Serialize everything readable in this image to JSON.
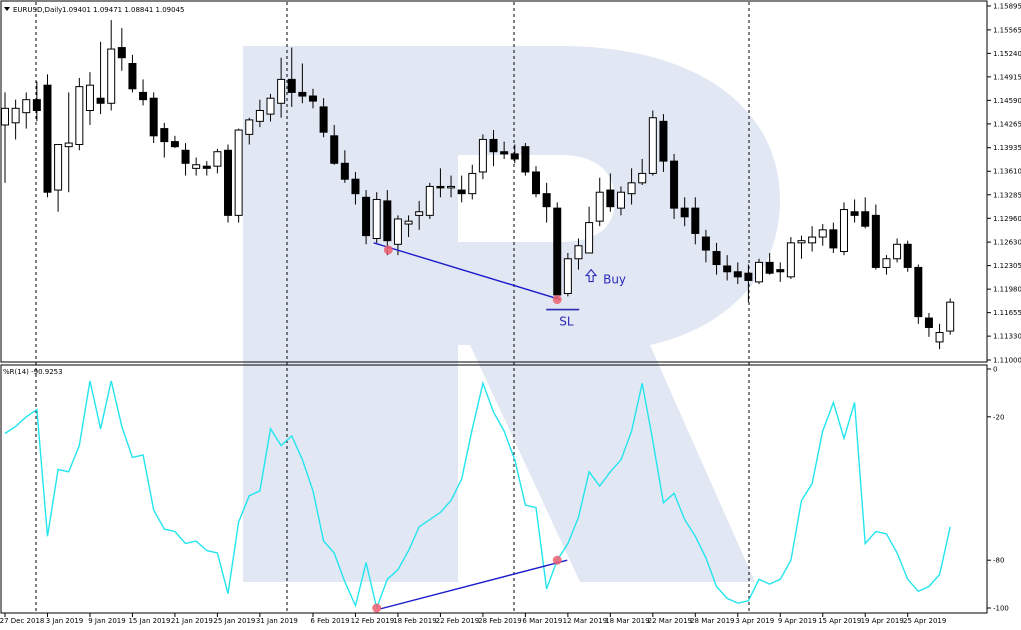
{
  "window": {
    "symbol_title": "EURUSD,Daily",
    "ohlc_text": "1.09401 1.09471 1.08841 1.09045"
  },
  "indicator": {
    "title": "%R(14) -90.9253"
  },
  "annotations": {
    "buy": "Buy",
    "sl": "SL"
  },
  "colors": {
    "bull_fill": "#ffffff",
    "bear_fill": "#000000",
    "wick": "#000000",
    "wpr_line": "#22e5ee",
    "divergence_line": "#1c1ccc",
    "marker": "#ef5f6e",
    "annotation": "#2a2ab8",
    "watermark": "#dde3f2",
    "grid": "#000000"
  },
  "chart_data": [
    {
      "type": "candlestick",
      "title": "EURUSD,Daily",
      "price_axis_ticks": [
        "1.15895",
        "1.15565",
        "1.15240",
        "1.14915",
        "1.14590",
        "1.14265",
        "1.13935",
        "1.13610",
        "1.13285",
        "1.12960",
        "1.12630",
        "1.12305",
        "1.11980",
        "1.11655",
        "1.11330",
        "1.11000"
      ],
      "ylim": [
        1.11,
        1.15895
      ],
      "date_axis_labels": [
        "27 Dec 2018",
        "3 Jan 2019",
        "9 Jan 2019",
        "15 Jan 2019",
        "21 Jan 2019",
        "25 Jan 2019",
        "31 Jan 2019",
        "6 Feb 2019",
        "12 Feb 2019",
        "18 Feb 2019",
        "22 Feb 2019",
        "28 Feb 2019",
        "6 Mar 2019",
        "12 Mar 2019",
        "18 Mar 2019",
        "22 Mar 2019",
        "28 Mar 2019",
        "3 Apr 2019",
        "9 Apr 2019",
        "15 Apr 2019",
        "19 Apr 2019",
        "25 Apr 2019"
      ],
      "candles": [
        {
          "o": 1.1425,
          "h": 1.147,
          "l": 1.1345,
          "c": 1.1448
        },
        {
          "o": 1.1428,
          "h": 1.146,
          "l": 1.1405,
          "c": 1.1448
        },
        {
          "o": 1.1442,
          "h": 1.147,
          "l": 1.142,
          "c": 1.146
        },
        {
          "o": 1.146,
          "h": 1.1485,
          "l": 1.143,
          "c": 1.1445
        },
        {
          "o": 1.148,
          "h": 1.1495,
          "l": 1.1325,
          "c": 1.1332
        },
        {
          "o": 1.1335,
          "h": 1.1398,
          "l": 1.1305,
          "c": 1.1398
        },
        {
          "o": 1.1395,
          "h": 1.147,
          "l": 1.1332,
          "c": 1.14
        },
        {
          "o": 1.1398,
          "h": 1.149,
          "l": 1.139,
          "c": 1.1478
        },
        {
          "o": 1.1445,
          "h": 1.1498,
          "l": 1.1425,
          "c": 1.148
        },
        {
          "o": 1.1462,
          "h": 1.154,
          "l": 1.144,
          "c": 1.1455
        },
        {
          "o": 1.1455,
          "h": 1.157,
          "l": 1.1445,
          "c": 1.153
        },
        {
          "o": 1.1532,
          "h": 1.1559,
          "l": 1.15,
          "c": 1.1518
        },
        {
          "o": 1.151,
          "h": 1.1522,
          "l": 1.147,
          "c": 1.1475
        },
        {
          "o": 1.147,
          "h": 1.1488,
          "l": 1.1452,
          "c": 1.146
        },
        {
          "o": 1.1462,
          "h": 1.147,
          "l": 1.14,
          "c": 1.141
        },
        {
          "o": 1.142,
          "h": 1.1428,
          "l": 1.138,
          "c": 1.1402
        },
        {
          "o": 1.1402,
          "h": 1.141,
          "l": 1.1393,
          "c": 1.1395
        },
        {
          "o": 1.139,
          "h": 1.14,
          "l": 1.1355,
          "c": 1.1372
        },
        {
          "o": 1.1365,
          "h": 1.138,
          "l": 1.1355,
          "c": 1.137
        },
        {
          "o": 1.1368,
          "h": 1.1375,
          "l": 1.1355,
          "c": 1.1365
        },
        {
          "o": 1.1368,
          "h": 1.1392,
          "l": 1.1358,
          "c": 1.1388
        },
        {
          "o": 1.139,
          "h": 1.1398,
          "l": 1.129,
          "c": 1.13
        },
        {
          "o": 1.13,
          "h": 1.142,
          "l": 1.129,
          "c": 1.1418
        },
        {
          "o": 1.1412,
          "h": 1.1435,
          "l": 1.1398,
          "c": 1.1432
        },
        {
          "o": 1.143,
          "h": 1.146,
          "l": 1.1422,
          "c": 1.1445
        },
        {
          "o": 1.144,
          "h": 1.1468,
          "l": 1.143,
          "c": 1.1462
        },
        {
          "o": 1.1455,
          "h": 1.1518,
          "l": 1.1435,
          "c": 1.1488
        },
        {
          "o": 1.1488,
          "h": 1.1532,
          "l": 1.145,
          "c": 1.147
        },
        {
          "o": 1.147,
          "h": 1.151,
          "l": 1.1455,
          "c": 1.1465
        },
        {
          "o": 1.1465,
          "h": 1.1475,
          "l": 1.1448,
          "c": 1.1458
        },
        {
          "o": 1.145,
          "h": 1.1462,
          "l": 1.1408,
          "c": 1.1415
        },
        {
          "o": 1.141,
          "h": 1.1425,
          "l": 1.137,
          "c": 1.1372
        },
        {
          "o": 1.1372,
          "h": 1.139,
          "l": 1.1345,
          "c": 1.135
        },
        {
          "o": 1.135,
          "h": 1.136,
          "l": 1.1315,
          "c": 1.133
        },
        {
          "o": 1.1325,
          "h": 1.1335,
          "l": 1.126,
          "c": 1.1272
        },
        {
          "o": 1.1268,
          "h": 1.1332,
          "l": 1.1262,
          "c": 1.1322
        },
        {
          "o": 1.132,
          "h": 1.1335,
          "l": 1.1245,
          "c": 1.1265
        },
        {
          "o": 1.126,
          "h": 1.13,
          "l": 1.1245,
          "c": 1.1295
        },
        {
          "o": 1.1288,
          "h": 1.13,
          "l": 1.127,
          "c": 1.1292
        },
        {
          "o": 1.13,
          "h": 1.132,
          "l": 1.128,
          "c": 1.1305
        },
        {
          "o": 1.13,
          "h": 1.1345,
          "l": 1.1295,
          "c": 1.134
        },
        {
          "o": 1.134,
          "h": 1.1365,
          "l": 1.1325,
          "c": 1.1338
        },
        {
          "o": 1.1338,
          "h": 1.1355,
          "l": 1.1325,
          "c": 1.134
        },
        {
          "o": 1.1335,
          "h": 1.1355,
          "l": 1.1318,
          "c": 1.133
        },
        {
          "o": 1.133,
          "h": 1.137,
          "l": 1.1322,
          "c": 1.1358
        },
        {
          "o": 1.136,
          "h": 1.1412,
          "l": 1.135,
          "c": 1.1405
        },
        {
          "o": 1.1405,
          "h": 1.1418,
          "l": 1.1368,
          "c": 1.1388
        },
        {
          "o": 1.1388,
          "h": 1.1402,
          "l": 1.1378,
          "c": 1.1385
        },
        {
          "o": 1.1385,
          "h": 1.1398,
          "l": 1.1372,
          "c": 1.1378
        },
        {
          "o": 1.1395,
          "h": 1.14,
          "l": 1.1355,
          "c": 1.136
        },
        {
          "o": 1.136,
          "h": 1.1368,
          "l": 1.1325,
          "c": 1.133
        },
        {
          "o": 1.133,
          "h": 1.1345,
          "l": 1.129,
          "c": 1.1312
        },
        {
          "o": 1.131,
          "h": 1.1318,
          "l": 1.1185,
          "c": 1.119
        },
        {
          "o": 1.1192,
          "h": 1.1248,
          "l": 1.1188,
          "c": 1.124
        },
        {
          "o": 1.124,
          "h": 1.1268,
          "l": 1.1225,
          "c": 1.1258
        },
        {
          "o": 1.1248,
          "h": 1.1312,
          "l": 1.1248,
          "c": 1.129
        },
        {
          "o": 1.1292,
          "h": 1.1352,
          "l": 1.1285,
          "c": 1.1332
        },
        {
          "o": 1.1335,
          "h": 1.1358,
          "l": 1.1305,
          "c": 1.1312
        },
        {
          "o": 1.131,
          "h": 1.134,
          "l": 1.13,
          "c": 1.1332
        },
        {
          "o": 1.133,
          "h": 1.1365,
          "l": 1.1315,
          "c": 1.1345
        },
        {
          "o": 1.1345,
          "h": 1.1378,
          "l": 1.1342,
          "c": 1.1358
        },
        {
          "o": 1.1358,
          "h": 1.1445,
          "l": 1.1355,
          "c": 1.1435
        },
        {
          "o": 1.143,
          "h": 1.144,
          "l": 1.136,
          "c": 1.1375
        },
        {
          "o": 1.1375,
          "h": 1.1385,
          "l": 1.1295,
          "c": 1.131
        },
        {
          "o": 1.131,
          "h": 1.1325,
          "l": 1.1285,
          "c": 1.1298
        },
        {
          "o": 1.131,
          "h": 1.1325,
          "l": 1.126,
          "c": 1.1275
        },
        {
          "o": 1.127,
          "h": 1.128,
          "l": 1.1235,
          "c": 1.1252
        },
        {
          "o": 1.125,
          "h": 1.1262,
          "l": 1.1218,
          "c": 1.1232
        },
        {
          "o": 1.123,
          "h": 1.1245,
          "l": 1.121,
          "c": 1.1222
        },
        {
          "o": 1.1222,
          "h": 1.1235,
          "l": 1.1205,
          "c": 1.1215
        },
        {
          "o": 1.122,
          "h": 1.1232,
          "l": 1.118,
          "c": 1.121
        },
        {
          "o": 1.1208,
          "h": 1.124,
          "l": 1.1205,
          "c": 1.1235
        },
        {
          "o": 1.1235,
          "h": 1.1248,
          "l": 1.1218,
          "c": 1.122
        },
        {
          "o": 1.1225,
          "h": 1.1235,
          "l": 1.1208,
          "c": 1.1222
        },
        {
          "o": 1.1215,
          "h": 1.127,
          "l": 1.1212,
          "c": 1.1262
        },
        {
          "o": 1.1262,
          "h": 1.1272,
          "l": 1.124,
          "c": 1.1265
        },
        {
          "o": 1.1262,
          "h": 1.1285,
          "l": 1.125,
          "c": 1.127
        },
        {
          "o": 1.127,
          "h": 1.1288,
          "l": 1.1258,
          "c": 1.128
        },
        {
          "o": 1.128,
          "h": 1.129,
          "l": 1.1248,
          "c": 1.1255
        },
        {
          "o": 1.125,
          "h": 1.1318,
          "l": 1.1245,
          "c": 1.1308
        },
        {
          "o": 1.1305,
          "h": 1.1322,
          "l": 1.129,
          "c": 1.13
        },
        {
          "o": 1.1305,
          "h": 1.1325,
          "l": 1.1282,
          "c": 1.1285
        },
        {
          "o": 1.13,
          "h": 1.1315,
          "l": 1.1225,
          "c": 1.1228
        },
        {
          "o": 1.1228,
          "h": 1.1245,
          "l": 1.1218,
          "c": 1.124
        },
        {
          "o": 1.124,
          "h": 1.1268,
          "l": 1.1235,
          "c": 1.126
        },
        {
          "o": 1.126,
          "h": 1.1265,
          "l": 1.1222,
          "c": 1.1228
        },
        {
          "o": 1.1228,
          "h": 1.1232,
          "l": 1.115,
          "c": 1.116
        },
        {
          "o": 1.1158,
          "h": 1.1165,
          "l": 1.1132,
          "c": 1.1145
        },
        {
          "o": 1.1125,
          "h": 1.115,
          "l": 1.1115,
          "c": 1.1138
        },
        {
          "o": 1.114,
          "h": 1.1185,
          "l": 1.1135,
          "c": 1.118
        }
      ]
    },
    {
      "type": "line",
      "title": "%R(14) -90.9253",
      "ylim": [
        -100,
        0
      ],
      "value_axis_ticks": [
        "0",
        "-20",
        "-80",
        "-100"
      ],
      "series": [
        {
          "values": [
            -27,
            -24,
            -20,
            -17,
            -70,
            -42,
            -43,
            -32,
            -5,
            -25,
            -5,
            -24,
            -37,
            -36,
            -59,
            -67,
            -68,
            -73,
            -72,
            -76,
            -77,
            -94,
            -64,
            -53,
            -51,
            -25,
            -32,
            -28,
            -38,
            -51,
            -72,
            -77,
            -89,
            -99,
            -81,
            -100,
            -88,
            -84,
            -76,
            -66,
            -63,
            -60,
            -55,
            -46,
            -25,
            -6,
            -18,
            -26,
            -38,
            -57,
            -58,
            -92,
            -80,
            -73,
            -62,
            -43,
            -49,
            -43,
            -38,
            -26,
            -6,
            -30,
            -56,
            -52,
            -63,
            -70,
            -79,
            -91,
            -96,
            -98,
            -97,
            -88,
            -90,
            -88,
            -80,
            -55,
            -48,
            -26,
            -14,
            -29,
            -14,
            -73,
            -68,
            -69,
            -77,
            -88,
            -93,
            -91,
            -86,
            -66
          ]
        }
      ]
    }
  ]
}
